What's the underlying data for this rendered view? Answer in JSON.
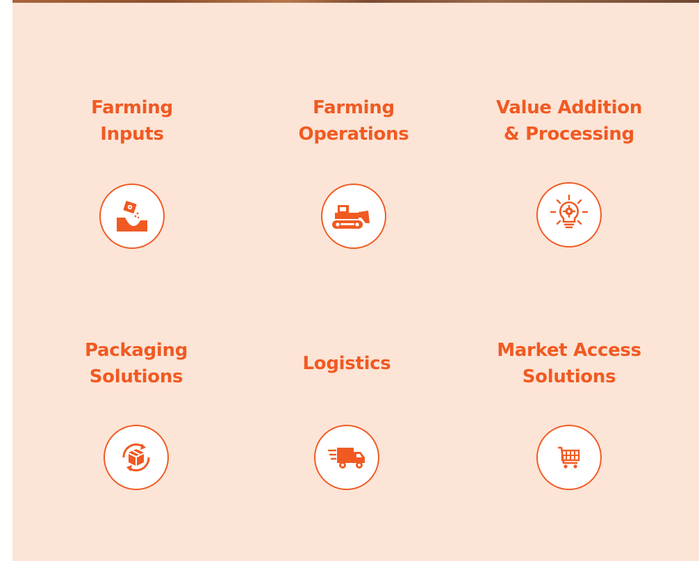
{
  "services": [
    {
      "title": "Farming\nInputs",
      "icon": "seed-planting-icon"
    },
    {
      "title": "Farming\nOperations",
      "icon": "bulldozer-icon"
    },
    {
      "title": "Value Addition\n& Processing",
      "icon": "lightbulb-gear-icon"
    },
    {
      "title": "Packaging\nSolutions",
      "icon": "box-recycle-icon"
    },
    {
      "title": "Logistics",
      "icon": "delivery-truck-icon"
    },
    {
      "title": "Market Access\nSolutions",
      "icon": "shopping-cart-icon"
    }
  ],
  "colors": {
    "accent": "#f05a22",
    "panel_background": "#fce4d6",
    "icon_background": "#ffffff"
  }
}
